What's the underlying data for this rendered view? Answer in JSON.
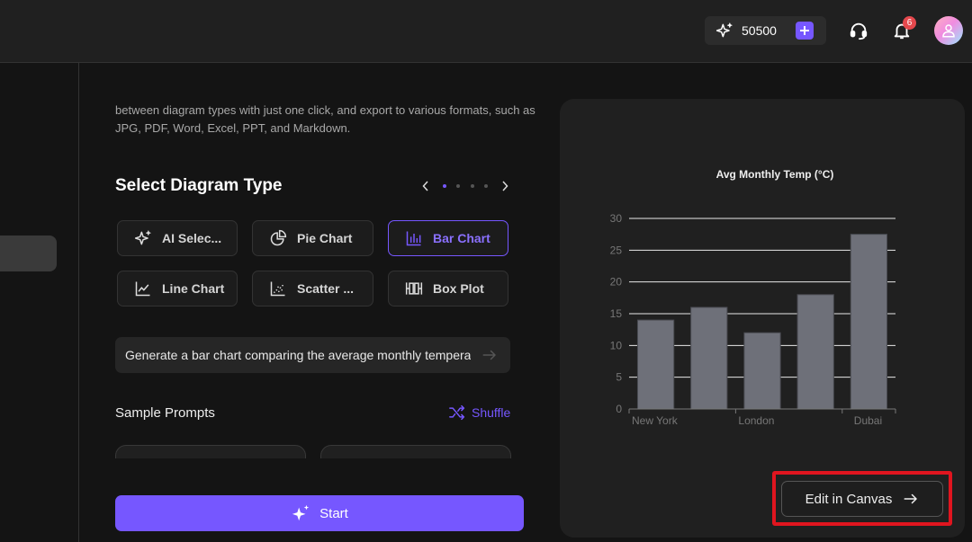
{
  "header": {
    "credits": "50500",
    "notification_count": "6"
  },
  "intro": {
    "description": "between diagram types with just one click, and export to various formats, such as JPG, PDF, Word, Excel, PPT, and Markdown."
  },
  "diagram_types": {
    "title": "Select Diagram Type",
    "carousel_pages": 4,
    "carousel_active": 1,
    "items": [
      {
        "label": "AI Selec...",
        "icon": "sparkle-icon",
        "active": false
      },
      {
        "label": "Pie Chart",
        "icon": "pie-chart-icon",
        "active": false
      },
      {
        "label": "Bar Chart",
        "icon": "bar-chart-icon",
        "active": true
      },
      {
        "label": "Line Chart",
        "icon": "line-chart-icon",
        "active": false
      },
      {
        "label": "Scatter ...",
        "icon": "scatter-plot-icon",
        "active": false
      },
      {
        "label": "Box Plot",
        "icon": "box-plot-icon",
        "active": false
      }
    ]
  },
  "prompt": {
    "value": "Generate a bar chart comparing the average monthly temperature"
  },
  "samples": {
    "title": "Sample Prompts",
    "shuffle_label": "Shuffle"
  },
  "start_label": "Start",
  "edit_label": "Edit in Canvas",
  "colors": {
    "accent": "#7657ff",
    "bar": "#6e7079",
    "highlight": "#e0151f",
    "badge": "#e5484d"
  },
  "chart_data": {
    "type": "bar",
    "title": "Avg Monthly Temp (°C)",
    "categories": [
      "New York",
      "",
      "London",
      "",
      "Dubai"
    ],
    "values": [
      14,
      16,
      12,
      18,
      27.5
    ],
    "xlabel": "",
    "ylabel": "",
    "ylim": [
      0,
      30
    ],
    "yticks": [
      0,
      5,
      10,
      15,
      20,
      25,
      30
    ],
    "grid": true,
    "legend": "none"
  }
}
